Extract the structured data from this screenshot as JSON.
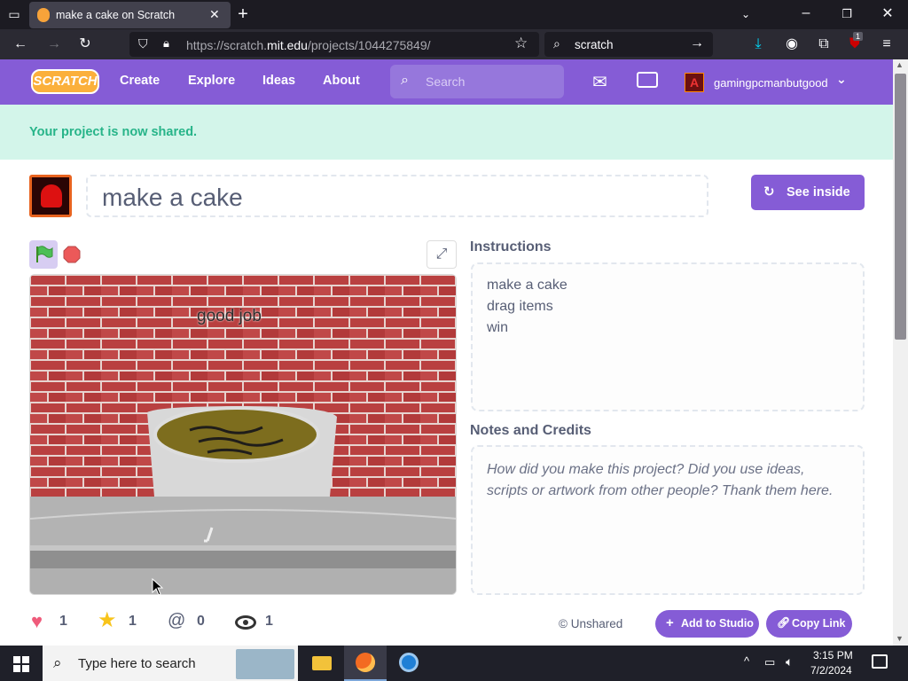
{
  "browser": {
    "tab_title": "make a cake on Scratch",
    "url_host_prefix": "https://scratch.",
    "url_host_main": "mit.edu",
    "url_path": "/projects/1044275849/",
    "search_value": "scratch",
    "extension_badge": "1"
  },
  "nav": {
    "logo_text": "SCRATCH",
    "create": "Create",
    "explore": "Explore",
    "ideas": "Ideas",
    "about": "About",
    "search_placeholder": "Search",
    "username": "gamingpcmanbutgood"
  },
  "banner": {
    "message": "Your project is now shared."
  },
  "project": {
    "title": "make a cake",
    "see_inside": "See inside",
    "stage_text": "good job",
    "instructions_title": "Instructions",
    "instructions": [
      "make a cake",
      "drag items",
      "win"
    ],
    "notes_title": "Notes and Credits",
    "notes_placeholder": [
      "How did you make this project? Did you use ideas,",
      "scripts or artwork from other people? Thank them here."
    ]
  },
  "stats": {
    "loves": "1",
    "favorites": "1",
    "remixes": "0",
    "views": "1"
  },
  "actions": {
    "share_status": "© Unshared",
    "add_to_studio": "Add to Studio",
    "copy_link": "Copy Link"
  },
  "taskbar": {
    "search_placeholder": "Type here to search",
    "time": "3:15 PM",
    "date": "7/2/2024"
  },
  "colors": {
    "scratch_purple": "#855cd6",
    "shared_green": "#27b489",
    "banner_bg": "#d3f5ea"
  }
}
